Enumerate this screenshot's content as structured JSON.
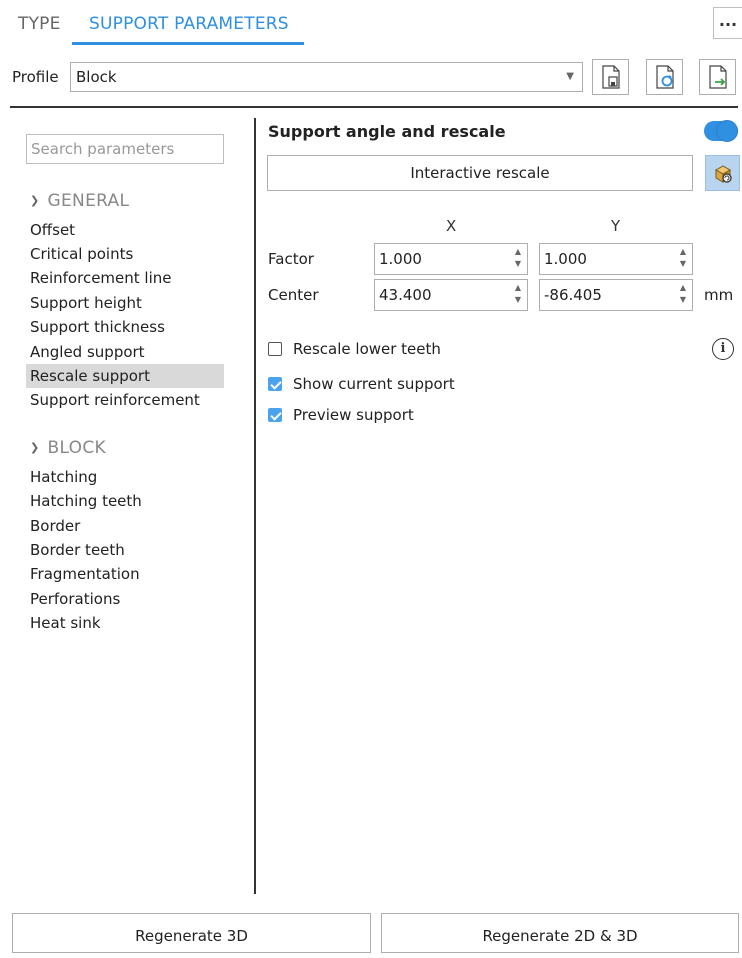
{
  "tabs": [
    {
      "label": "TYPE"
    },
    {
      "label": "SUPPORT PARAMETERS"
    }
  ],
  "more_label": "...",
  "profile": {
    "label": "Profile",
    "value": "Block"
  },
  "toolbar": {
    "icons": [
      "save-profile-icon",
      "reload-profile-icon",
      "export-profile-icon"
    ]
  },
  "sidebar": {
    "search_placeholder": "Search parameters",
    "groups": [
      {
        "title": "GENERAL",
        "items": [
          "Offset",
          "Critical points",
          "Reinforcement line",
          "Support height",
          "Support thickness",
          "Angled support",
          "Rescale support",
          "Support reinforcement"
        ]
      },
      {
        "title": "BLOCK",
        "items": [
          "Hatching",
          "Hatching teeth",
          "Border",
          "Border teeth",
          "Fragmentation",
          "Perforations",
          "Heat sink"
        ]
      }
    ],
    "selected_item": "Rescale support"
  },
  "main": {
    "section_title": "Support angle and rescale",
    "toggle_on": true,
    "interactive_rescale_label": "Interactive rescale",
    "col_x": "X",
    "col_y": "Y",
    "factor_label": "Factor",
    "factor_x": "1.000",
    "factor_y": "1.000",
    "center_label": "Center",
    "center_x": "43.400",
    "center_y": "-86.405",
    "unit": "mm",
    "checkboxes": [
      {
        "label": "Rescale lower teeth",
        "checked": false
      },
      {
        "label": "Show current support",
        "checked": true
      },
      {
        "label": "Preview support",
        "checked": true
      }
    ]
  },
  "bottom": {
    "regenerate_3d": "Regenerate 3D",
    "regenerate_2d3d": "Regenerate 2D & 3D"
  },
  "colors": {
    "accent": "#2f8fe0",
    "selected_bg": "#d9d9d9"
  }
}
